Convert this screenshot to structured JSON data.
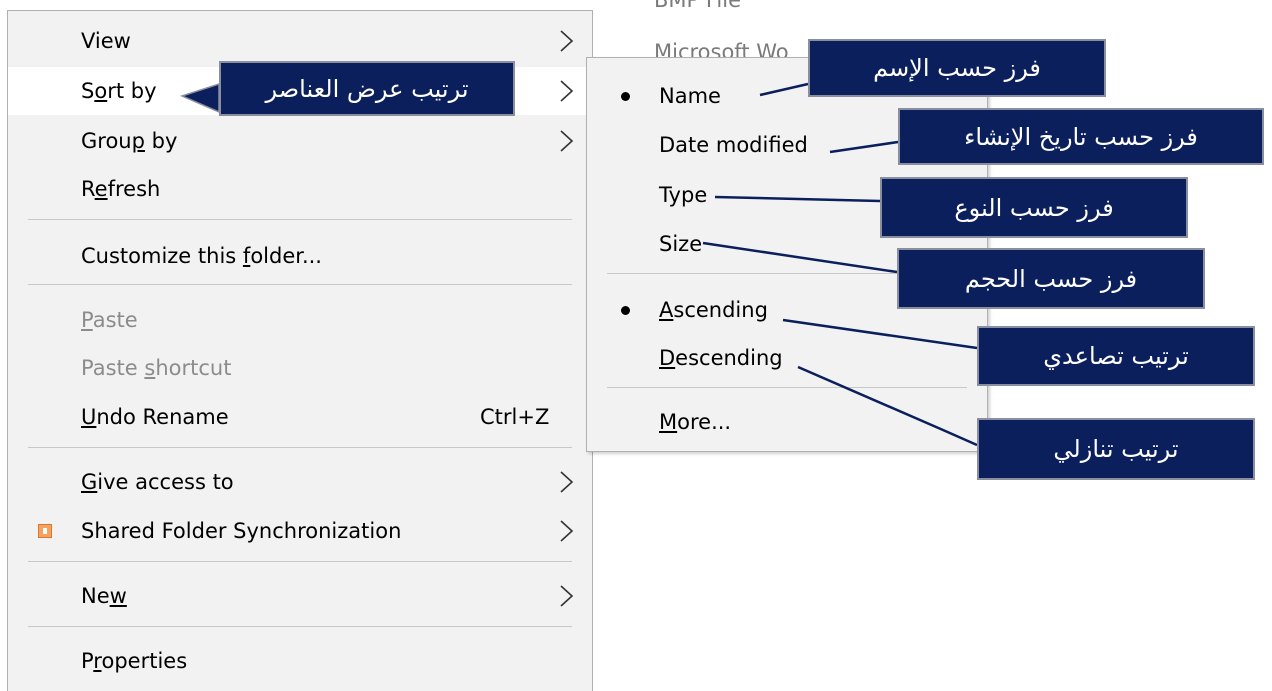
{
  "background": {
    "file_type_text": "BMP File",
    "app_text": "Microsoft Wo"
  },
  "menu": {
    "view": "View",
    "sort_by": {
      "pre": "S",
      "acc": "o",
      "post": "rt by"
    },
    "group_by": {
      "pre": "Grou",
      "acc": "p",
      "post": " by"
    },
    "refresh": {
      "pre": "R",
      "acc": "e",
      "post": "fresh"
    },
    "customize": {
      "pre": "Customize this ",
      "acc": "f",
      "post": "older..."
    },
    "paste": {
      "pre": "",
      "acc": "P",
      "post": "aste"
    },
    "paste_shortcut": {
      "pre": "Paste ",
      "acc": "s",
      "post": "hortcut"
    },
    "undo_rename": {
      "pre": "",
      "acc": "U",
      "post": "ndo Rename"
    },
    "undo_shortcut": "Ctrl+Z",
    "give_access": {
      "pre": "",
      "acc": "G",
      "post": "ive access to"
    },
    "shared_sync": "Shared Folder Synchronization",
    "new": {
      "pre": "Ne",
      "acc": "w",
      "post": ""
    },
    "properties": {
      "pre": "P",
      "acc": "r",
      "post": "operties"
    }
  },
  "submenu": {
    "name": "Name",
    "date_modified": "Date modified",
    "type": "Type",
    "size": "Size",
    "ascending": {
      "pre": "",
      "acc": "A",
      "post": "scending"
    },
    "descending": {
      "pre": "",
      "acc": "D",
      "post": "escending"
    },
    "more": {
      "pre": "",
      "acc": "M",
      "post": "ore..."
    }
  },
  "callouts": {
    "sort_display": "ترتيب عرض العناصر",
    "by_name": "فرز حسب الإسم",
    "by_date": "فرز حسب تاريخ الإنشاء",
    "by_type": "فرز حسب النوع",
    "by_size": "فرز حسب الحجم",
    "ascending": "ترتيب تصاعدي",
    "descending": "ترتيب تنازلي"
  },
  "colors": {
    "callout_bg": "#0b1f5c",
    "menu_bg": "#f2f2f2",
    "highlight": "#ffffff"
  }
}
